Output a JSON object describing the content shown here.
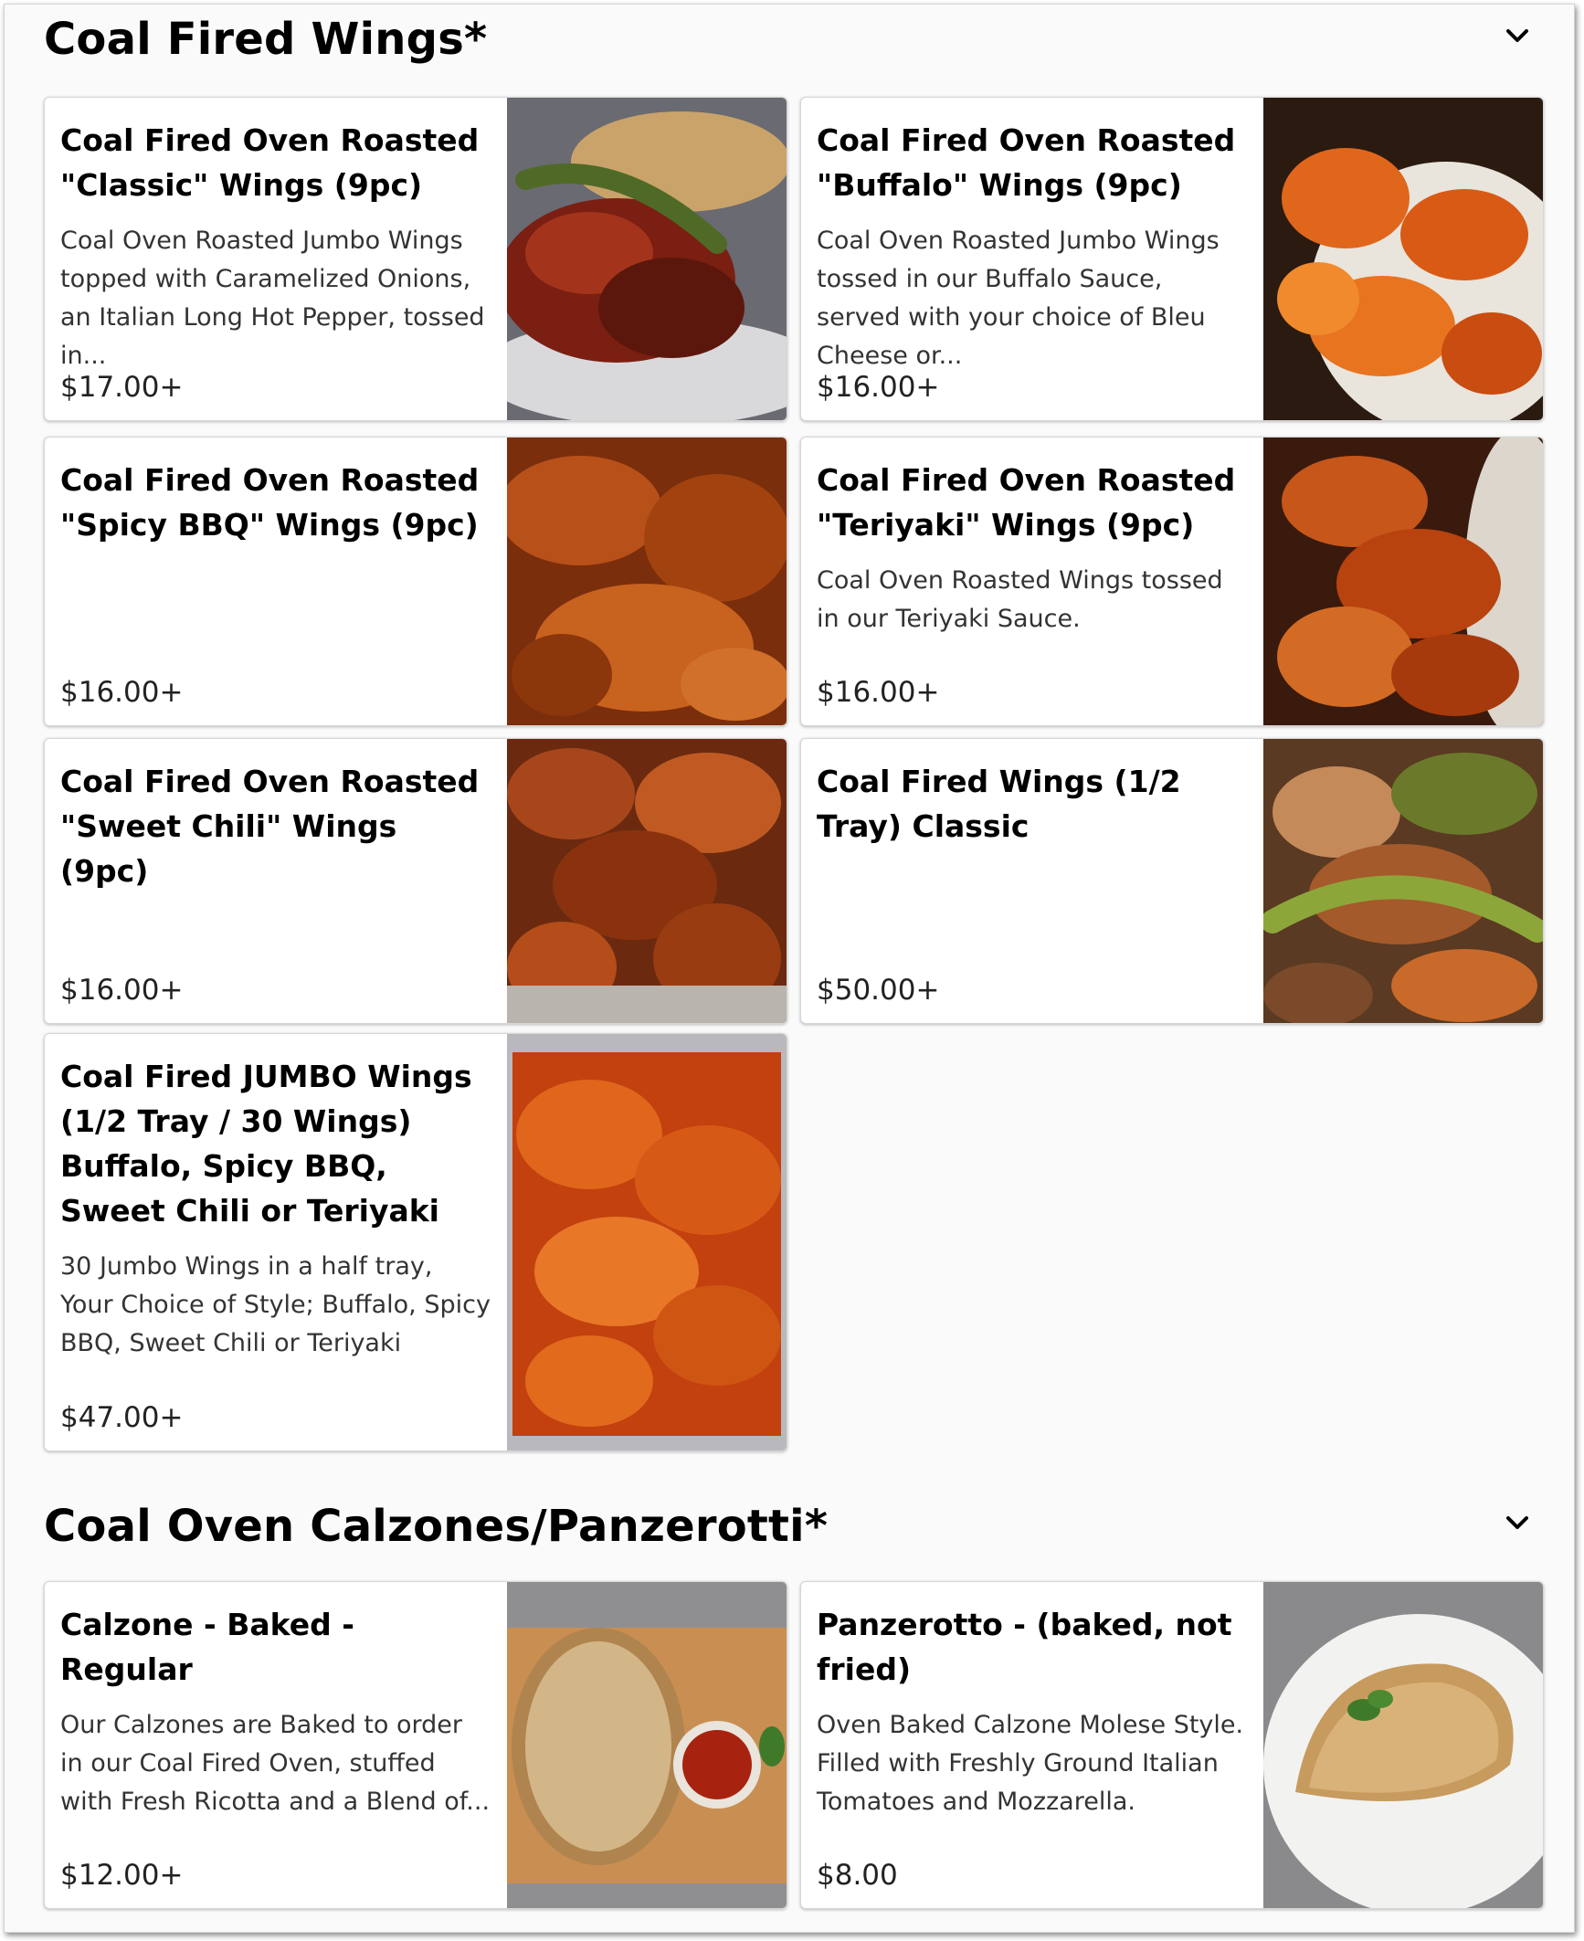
{
  "sections": [
    {
      "title": "Coal Fired Wings*",
      "items": [
        {
          "name": "Coal Fired Oven Roasted \"Classic\" Wings (9pc)",
          "description": "Coal Oven Roasted Jumbo Wings topped with Caramelized Onions, an Italian Long Hot Pepper, tossed in...",
          "price": "$17.00+"
        },
        {
          "name": "Coal Fired Oven Roasted \"Buffalo\" Wings (9pc)",
          "description": "Coal Oven Roasted Jumbo Wings tossed in our Buffalo Sauce, served with your choice of Bleu Cheese or...",
          "price": "$16.00+"
        },
        {
          "name": "Coal Fired Oven Roasted \"Spicy BBQ\" Wings (9pc)",
          "description": "",
          "price": "$16.00+"
        },
        {
          "name": "Coal Fired Oven Roasted \"Teriyaki\" Wings (9pc)",
          "description": "Coal Oven Roasted Wings tossed in our Teriyaki Sauce.",
          "price": "$16.00+"
        },
        {
          "name": "Coal Fired Oven Roasted \"Sweet Chili\" Wings (9pc)",
          "description": "",
          "price": "$16.00+"
        },
        {
          "name": "Coal Fired Wings (1/2 Tray) Classic",
          "description": "",
          "price": "$50.00+"
        },
        {
          "name": "Coal Fired JUMBO Wings (1/2 Tray / 30 Wings) Buffalo, Spicy BBQ, Sweet Chili or Teriyaki",
          "description": "30 Jumbo Wings in a half tray, Your Choice of Style; Buffalo, Spicy BBQ, Sweet Chili or Teriyaki",
          "price": "$47.00+"
        }
      ]
    },
    {
      "title": "Coal Oven Calzones/Panzerotti*",
      "items": [
        {
          "name": "Calzone - Baked - Regular",
          "description": "Our Calzones are Baked to order in our Coal Fired Oven, stuffed with Fresh Ricotta and a Blend of...",
          "price": "$12.00+"
        },
        {
          "name": "Panzerotto - (baked, not fried)",
          "description": "Oven Baked Calzone Molese Style. Filled with Freshly Ground Italian Tomatoes and Mozzarella.",
          "price": "$8.00"
        }
      ]
    }
  ],
  "icons": {
    "collapse": "chevron-down-icon"
  },
  "colors": {
    "background": "#fafafa",
    "card": "#ffffff",
    "text": "#000000"
  }
}
